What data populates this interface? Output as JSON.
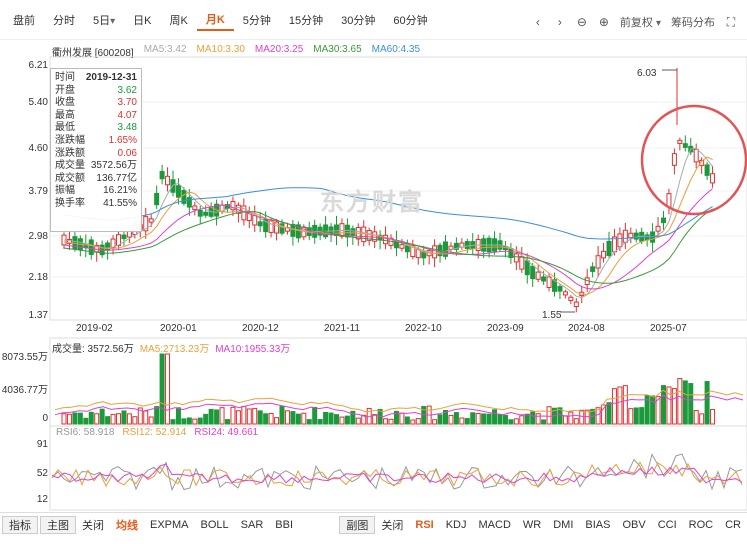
{
  "period_tabs": [
    "盘前",
    "分时",
    "5日",
    "日K",
    "周K",
    "月K",
    "5分钟",
    "15分钟",
    "30分钟",
    "60分钟"
  ],
  "active_tab": "月K",
  "tab5_arrow": "▾",
  "tools": {
    "prev": "‹",
    "next": "›",
    "zoom_out": "⊖",
    "zoom_in": "⊕",
    "adjust": "前复权",
    "adjust_arrow": "▾",
    "chip": "筹码分布",
    "fullscreen": "⛶"
  },
  "legend": {
    "name": "衢州发展 [600208]",
    "items": [
      {
        "label": "MA5:3.42",
        "color": "#aaaaaa"
      },
      {
        "label": "MA10:3.30",
        "color": "#e8a03c"
      },
      {
        "label": "MA20:3.25",
        "color": "#e040d0"
      },
      {
        "label": "MA30:3.65",
        "color": "#3a9a3a"
      },
      {
        "label": "MA60:4.35",
        "color": "#3a8fd8"
      }
    ]
  },
  "price_axis": [
    "6.21",
    "5.40",
    "4.60",
    "3.79",
    "2.98",
    "2.18",
    "1.37"
  ],
  "date_axis": [
    "2019-02",
    "2020-01",
    "2020-12",
    "2021-11",
    "2022-10",
    "2023-09",
    "2024-08",
    "2025-07"
  ],
  "annotations": {
    "high": "6.03",
    "low": "1.55"
  },
  "info": [
    {
      "k": "时间",
      "v": "2019-12-31",
      "c": "#333"
    },
    {
      "k": "开盘",
      "v": "3.62",
      "c": "#1a9a3a"
    },
    {
      "k": "收盘",
      "v": "3.70",
      "c": "#e03030"
    },
    {
      "k": "最高",
      "v": "4.07",
      "c": "#e03030"
    },
    {
      "k": "最低",
      "v": "3.48",
      "c": "#1a9a3a"
    },
    {
      "k": "涨跌幅",
      "v": "1.65%",
      "c": "#e03030"
    },
    {
      "k": "涨跌额",
      "v": "0.06",
      "c": "#e03030"
    },
    {
      "k": "成交量",
      "v": "3572.56万",
      "c": "#333"
    },
    {
      "k": "成交额",
      "v": "136.77亿",
      "c": "#333"
    },
    {
      "k": "振幅",
      "v": "16.21%",
      "c": "#333"
    },
    {
      "k": "换手率",
      "v": "41.55%",
      "c": "#333"
    }
  ],
  "watermark": "东方财富",
  "volume_legend": [
    {
      "label": "成交量: 3572.56万",
      "color": "#333"
    },
    {
      "label": "MA5:2713.23万",
      "color": "#e8a03c"
    },
    {
      "label": "MA10:1955.33万",
      "color": "#e040d0"
    }
  ],
  "volume_axis": [
    "8073.55万",
    "4036.77万",
    "0"
  ],
  "rsi_legend": [
    {
      "label": "RSI6: 58.918",
      "color": "#999"
    },
    {
      "label": "RSI12: 52.914",
      "color": "#e8a03c"
    },
    {
      "label": "RSI24: 49.661",
      "color": "#e040d0"
    }
  ],
  "rsi_axis": [
    "91",
    "52",
    "12"
  ],
  "bottom_left": [
    {
      "label": "指标",
      "style": "boxed"
    },
    {
      "label": "主图",
      "style": "boxed"
    },
    {
      "label": "关闭",
      "style": ""
    },
    {
      "label": "均线",
      "style": "active"
    },
    {
      "label": "EXPMA",
      "style": ""
    },
    {
      "label": "BOLL",
      "style": ""
    },
    {
      "label": "SAR",
      "style": ""
    },
    {
      "label": "BBI",
      "style": ""
    }
  ],
  "bottom_right": [
    {
      "label": "副图",
      "style": "boxed"
    },
    {
      "label": "关闭",
      "style": ""
    },
    {
      "label": "RSI",
      "style": "active"
    },
    {
      "label": "KDJ",
      "style": ""
    },
    {
      "label": "MACD",
      "style": ""
    },
    {
      "label": "WR",
      "style": ""
    },
    {
      "label": "DMI",
      "style": ""
    },
    {
      "label": "BIAS",
      "style": ""
    },
    {
      "label": "OBV",
      "style": ""
    },
    {
      "label": "CCI",
      "style": ""
    },
    {
      "label": "ROC",
      "style": ""
    },
    {
      "label": "CR",
      "style": ""
    }
  ]
}
